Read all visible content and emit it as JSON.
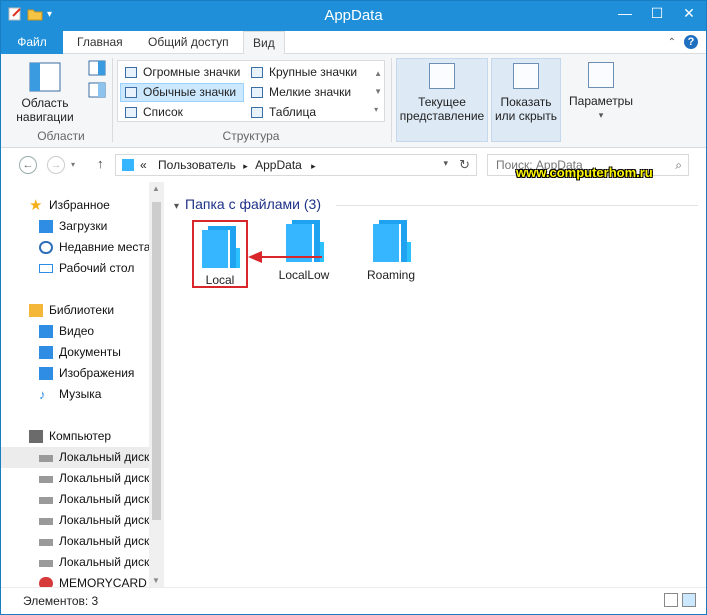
{
  "window": {
    "title": "AppData"
  },
  "tabs": [
    {
      "label": "Файл"
    },
    {
      "label": "Главная"
    },
    {
      "label": "Общий доступ"
    },
    {
      "label": "Вид"
    }
  ],
  "ribbon": {
    "panes": {
      "nav_pane_label": "Область навигации",
      "group": "Области"
    },
    "layout": {
      "items": [
        {
          "label": "Огромные значки"
        },
        {
          "label": "Крупные значки"
        },
        {
          "label": "Обычные значки",
          "selected": true
        },
        {
          "label": "Мелкие значки"
        },
        {
          "label": "Список"
        },
        {
          "label": "Таблица"
        }
      ],
      "group": "Структура"
    },
    "current_view": "Текущее представление",
    "show_hide": "Показать или скрыть",
    "options": "Параметры"
  },
  "address": {
    "prefix": "«",
    "crumbs": [
      "Пользователь",
      "AppData"
    ],
    "search_placeholder": "Поиск: AppData"
  },
  "watermark": "www.computerhom.ru",
  "nav": {
    "favorites": {
      "title": "Избранное",
      "items": [
        "Загрузки",
        "Недавние места",
        "Рабочий стол"
      ]
    },
    "libraries": {
      "title": "Библиотеки",
      "items": [
        "Видео",
        "Документы",
        "Изображения",
        "Музыка"
      ]
    },
    "computer": {
      "title": "Компьютер",
      "items": [
        "Локальный диск",
        "Локальный диск",
        "Локальный диск",
        "Локальный диск",
        "Локальный диск",
        "Локальный диск",
        "MEMORYCARD ("
      ]
    }
  },
  "content": {
    "group_title": "Папка с файлами (3)",
    "folders": [
      {
        "name": "Local",
        "highlighted": true
      },
      {
        "name": "LocalLow"
      },
      {
        "name": "Roaming"
      }
    ]
  },
  "status": {
    "count": "Элементов: 3"
  },
  "colors": {
    "accent": "#1e8fd8",
    "folder": "#36b6ff",
    "highlight": "#d9262a",
    "watermark": "#fff600"
  }
}
